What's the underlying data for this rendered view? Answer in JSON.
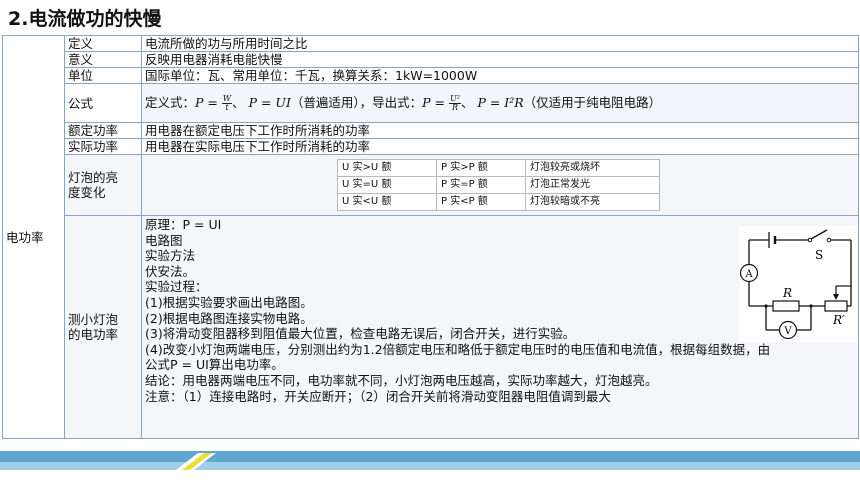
{
  "title": "2.电流做功的快慢",
  "row_header": "电功率",
  "rows": {
    "definition": {
      "label": "定义",
      "text": "电流所做的功与所用时间之比"
    },
    "meaning": {
      "label": "意义",
      "text": "反映用电器消耗电能快慢"
    },
    "unit": {
      "label": "单位",
      "text": "国际单位：瓦、常用单位：千瓦，换算关系：1kW=1000W"
    },
    "formula": {
      "label": "公式",
      "def_prefix": "定义式：",
      "def_lhs": "P =",
      "frac1_num": "W",
      "frac1_den": "t",
      "sep1": "、",
      "eq2": "P = UI",
      "general_note": "（普遍适用），导出式：",
      "eq3_lhs": "P =",
      "frac2_num": "U²",
      "frac2_den": "R",
      "sep2": "、",
      "eq4": "P = I²R",
      "pure_note": "（仅适用于纯电阻电路）"
    },
    "rated": {
      "label": "额定功率",
      "text": "用电器在额定电压下工作时所消耗的功率"
    },
    "actual": {
      "label": "实际功率",
      "text": "用电器在实际电压下工作时所消耗的功率"
    },
    "brightness": {
      "label": "灯泡的亮度变化",
      "label_l1": "灯泡的亮",
      "label_l2": "度变化",
      "table": [
        {
          "u": "U 实>U 额",
          "p": "P 实>P 额",
          "result": "灯泡较亮或烧坏"
        },
        {
          "u": "U 实=U 额",
          "p": "P 实=P 额",
          "result": "灯泡正常发光"
        },
        {
          "u": "U 实<U 额",
          "p": "P 实<P 额",
          "result": "灯泡较暗或不亮"
        }
      ]
    },
    "measure": {
      "label_l1": "测小灯泡",
      "label_l2": "的电功率",
      "lines": [
        "原理：P = UI",
        "电路图",
        "实验方法",
        "伏安法。",
        "实验过程：",
        "(1)根据实验要求画出电路图。",
        "(2)根据电路图连接实物电路。",
        "(3)将滑动变阻器移到阻值最大位置，检查电路无误后，闭合开关，进行实验。",
        "(4)改变小灯泡两端电压，分别测出约为1.2倍额定电压和略低于额定电压时的电压值和电流值，根据每组数据，由",
        "公式P = UI算出电功率。",
        "结论：用电器两端电压不同，电功率就不同，小灯泡两电压越高，实际功率越大，灯泡越亮。",
        "注意：（1）连接电路时，开关应断开；（2）闭合开关前将滑动变阻器电阻值调到最大"
      ],
      "circuit_labels": {
        "switch": "S",
        "ammeter": "A",
        "voltmeter": "V",
        "resistor": "R",
        "rheostat": "R′"
      }
    }
  },
  "colors": {
    "border": "#8aa4c4",
    "footer_dark": "#5fa7cf",
    "footer_light": "#9fcee6"
  }
}
